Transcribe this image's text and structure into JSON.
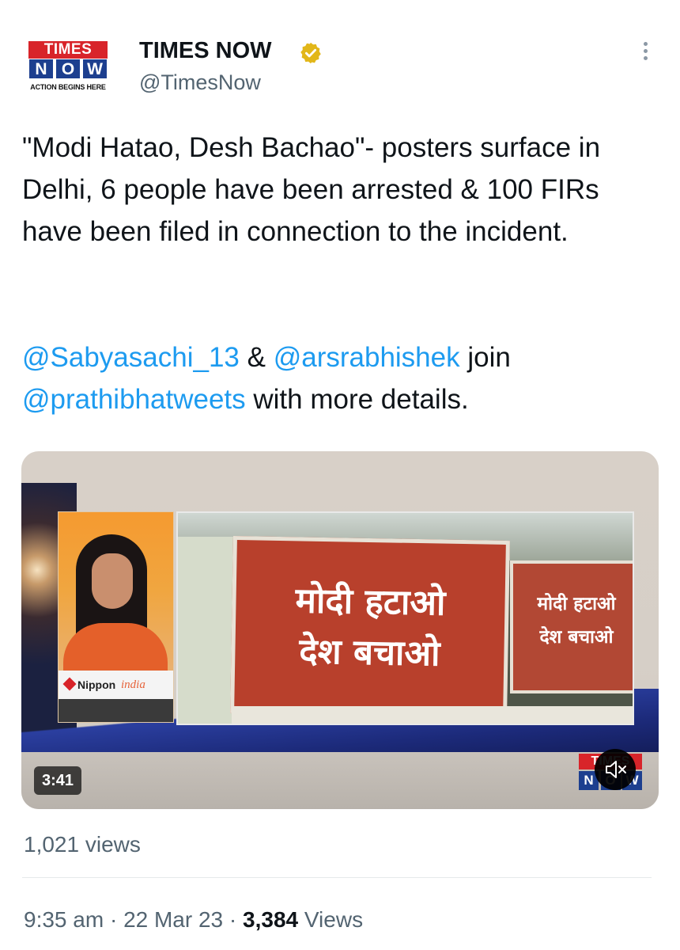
{
  "header": {
    "logo_top": "TIMES",
    "logo_bottom_letters": [
      "N",
      "O",
      "W"
    ],
    "logo_tagline": "ACTION BEGINS HERE",
    "display_name": "TIMES NOW",
    "verified_icon": "verified-badge-icon",
    "handle": "@TimesNow",
    "more_icon": "more-options-icon"
  },
  "tweet": {
    "text": "\"Modi Hatao, Desh Bachao\"- posters surface in Delhi, 6 people have been arrested & 100 FIRs have been filed in connection to the incident.",
    "mentions": {
      "m1": "@Sabyasachi_13",
      "sep": "&",
      "m2": "@arsrabhishek",
      "join": "join",
      "m3": "@prathibhatweets",
      "tail": "with more details."
    }
  },
  "media": {
    "poster_large_text": "मोदी हटाओ\nदेश बचाओ",
    "poster_small_text": "मोदी हटाओ\nदेश बचाओ",
    "sponsor": "Nippon",
    "sponsor_suffix": "india",
    "duration": "3:41",
    "watermark_top": "TIMES",
    "watermark_bottom_letters": [
      "N",
      "O",
      "W"
    ],
    "mute_icon": "muted-speaker-icon"
  },
  "stats": {
    "video_views": "1,021 views",
    "time": "9:35 am",
    "dot": "·",
    "date": "22 Mar 23",
    "view_count": "3,384",
    "views_label": "Views"
  },
  "colors": {
    "accent": "#1d9bf0",
    "text": "#0f1419",
    "secondary": "#536471",
    "brand_red": "#d8242a",
    "brand_blue": "#1d3f8f",
    "verified_gold": "#e2b719"
  }
}
